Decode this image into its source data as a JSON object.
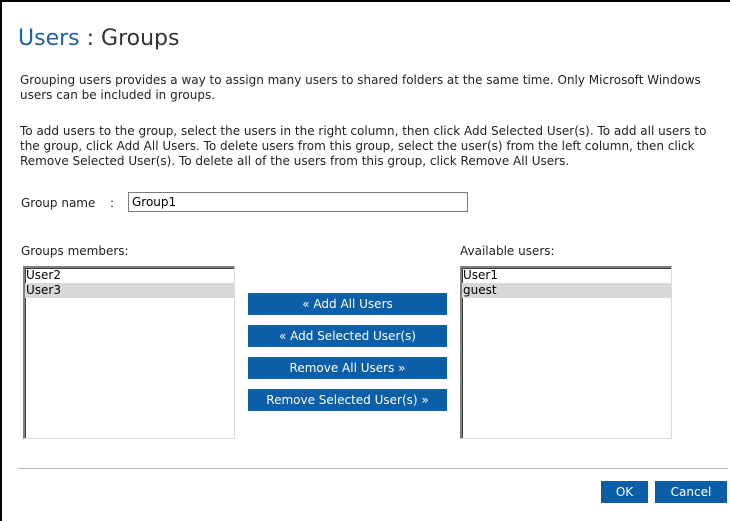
{
  "header": {
    "breadcrumb_link": "Users",
    "separator": ":",
    "page_title": "Groups"
  },
  "description": {
    "paragraph1": "Grouping users provides a way to assign many users to shared folders at the same time. Only Microsoft Windows users can be included in groups.",
    "paragraph2": "To add users to the group, select the users in the right column, then click Add Selected User(s). To add all users to the group, click Add All Users. To delete users from this group, select the user(s) from the left column, then click Remove Selected User(s). To delete all of the users from this group, click Remove All Users."
  },
  "group_name": {
    "label": "Group name",
    "colon": ":",
    "value": "Group1"
  },
  "members": {
    "label": "Groups members:",
    "items": [
      {
        "label": "User2",
        "selected": false
      },
      {
        "label": "User3",
        "selected": true
      }
    ]
  },
  "available": {
    "label": "Available users:",
    "items": [
      {
        "label": "User1",
        "selected": false
      },
      {
        "label": "guest",
        "selected": true
      }
    ]
  },
  "actions": {
    "add_all": "« Add All Users",
    "add_selected": "« Add Selected User(s)",
    "remove_all": "Remove All Users »",
    "remove_selected": "Remove Selected User(s) »"
  },
  "footer": {
    "ok": "OK",
    "cancel": "Cancel"
  },
  "colors": {
    "accent": "#0a5fa8",
    "link": "#1f5fa8",
    "selection": "#d8d8d8"
  }
}
